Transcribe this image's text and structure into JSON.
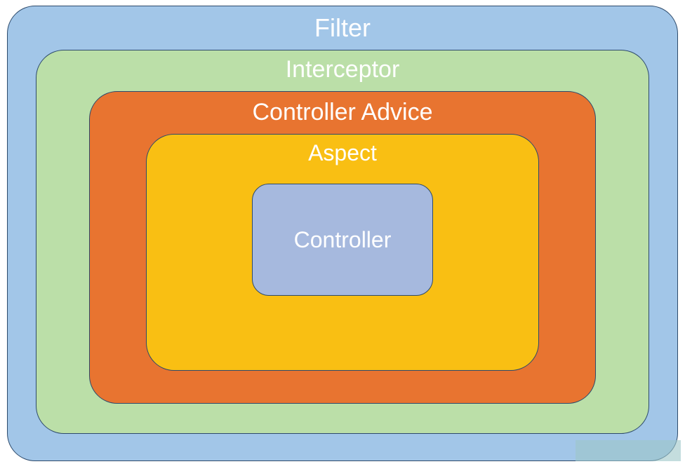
{
  "diagram": {
    "layers": [
      {
        "name": "Filter",
        "color": "#a2c6e8"
      },
      {
        "name": "Interceptor",
        "color": "#bbdfa8"
      },
      {
        "name": "Controller Advice",
        "color": "#e87430"
      },
      {
        "name": "Aspect",
        "color": "#f9bf13"
      },
      {
        "name": "Controller",
        "color": "#a6b9de"
      }
    ]
  }
}
